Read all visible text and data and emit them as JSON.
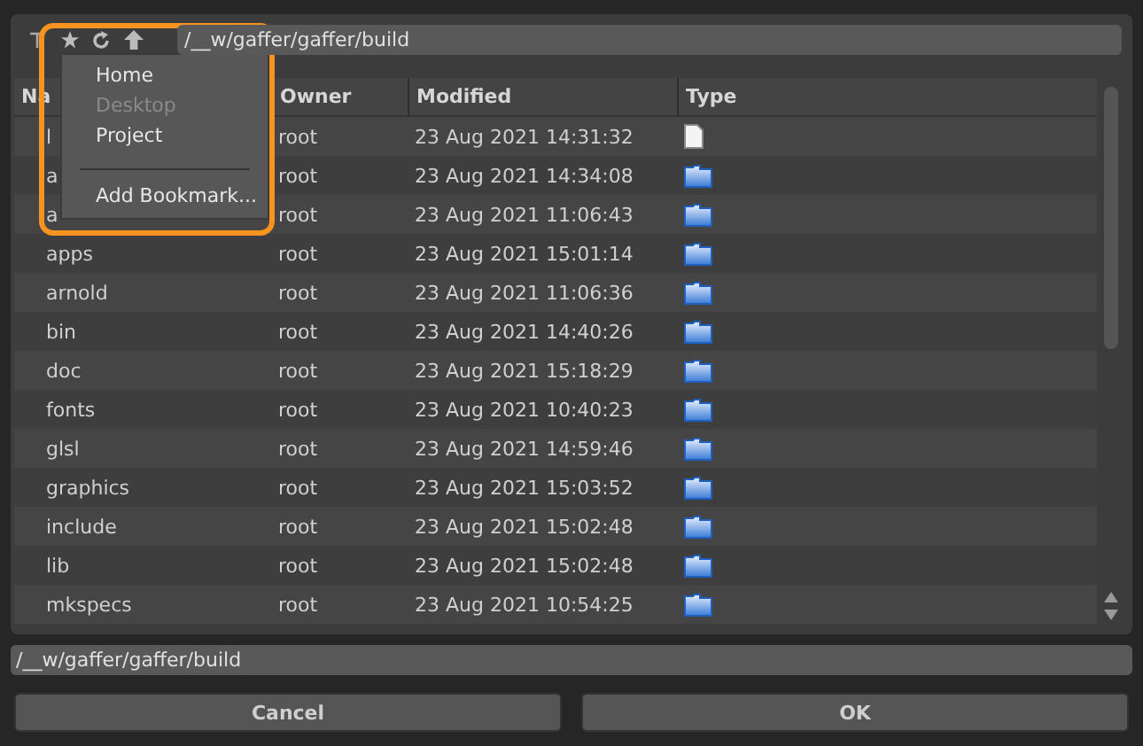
{
  "toolbar": {
    "path": "/__w/gaffer/gaffer/build"
  },
  "bookmark_menu": {
    "items": [
      {
        "label": "Home",
        "disabled": false
      },
      {
        "label": "Desktop",
        "disabled": true
      },
      {
        "label": "Project",
        "disabled": false
      }
    ],
    "add_label": "Add Bookmark..."
  },
  "table": {
    "columns": [
      "Na",
      "Owner",
      "Modified",
      "Type"
    ],
    "rows": [
      {
        "name": "l",
        "owner": "root",
        "modified": "23 Aug 2021 14:31:32",
        "kind": "file"
      },
      {
        "name": "a",
        "owner": "root",
        "modified": "23 Aug 2021 14:34:08",
        "kind": "folder"
      },
      {
        "name": "a",
        "owner": "root",
        "modified": "23 Aug 2021 11:06:43",
        "kind": "folder"
      },
      {
        "name": "apps",
        "owner": "root",
        "modified": "23 Aug 2021 15:01:14",
        "kind": "folder"
      },
      {
        "name": "arnold",
        "owner": "root",
        "modified": "23 Aug 2021 11:06:36",
        "kind": "folder"
      },
      {
        "name": "bin",
        "owner": "root",
        "modified": "23 Aug 2021 14:40:26",
        "kind": "folder"
      },
      {
        "name": "doc",
        "owner": "root",
        "modified": "23 Aug 2021 15:18:29",
        "kind": "folder"
      },
      {
        "name": "fonts",
        "owner": "root",
        "modified": "23 Aug 2021 10:40:23",
        "kind": "folder"
      },
      {
        "name": "glsl",
        "owner": "root",
        "modified": "23 Aug 2021 14:59:46",
        "kind": "folder"
      },
      {
        "name": "graphics",
        "owner": "root",
        "modified": "23 Aug 2021 15:03:52",
        "kind": "folder"
      },
      {
        "name": "include",
        "owner": "root",
        "modified": "23 Aug 2021 15:02:48",
        "kind": "folder"
      },
      {
        "name": "lib",
        "owner": "root",
        "modified": "23 Aug 2021 15:02:48",
        "kind": "folder"
      },
      {
        "name": "mkspecs",
        "owner": "root",
        "modified": "23 Aug 2021 10:54:25",
        "kind": "folder"
      }
    ]
  },
  "path_field": {
    "value": "/__w/gaffer/gaffer/build"
  },
  "buttons": [
    "Cancel",
    "OK"
  ]
}
